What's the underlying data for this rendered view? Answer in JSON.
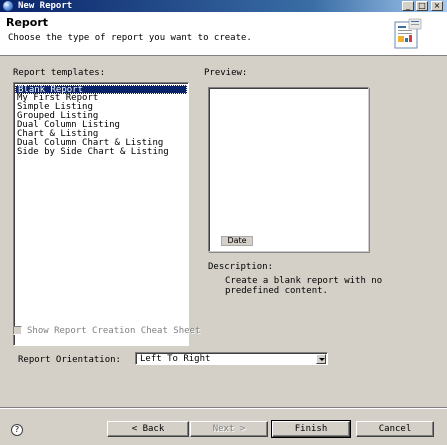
{
  "window": {
    "title": "New Report",
    "controls": [
      "minimize",
      "maximize",
      "close"
    ]
  },
  "header": {
    "title": "Report",
    "description": "Choose the type of report you want to create.",
    "icon": "report-wizard-icon"
  },
  "templates": {
    "label": "Report templates:",
    "selected": "Blank Report",
    "items": [
      "Blank Report",
      "My First Report",
      "Simple Listing",
      "Grouped Listing",
      "Dual Column Listing",
      "Chart & Listing",
      "Dual Column Chart & Listing",
      "Side by Side Chart & Listing"
    ]
  },
  "preview": {
    "label": "Preview:",
    "date_label": "Date"
  },
  "description": {
    "label": "Description:",
    "text": "Create a blank report with no\npredefined content."
  },
  "cheat_sheet": {
    "label": "Show Report Creation Cheat Sheet",
    "checked": false,
    "enabled": false
  },
  "orientation": {
    "label": "Report Orientation:",
    "value": "Left To Right"
  },
  "buttons": {
    "back": "< Back",
    "next": "Next >",
    "finish": "Finish",
    "cancel": "Cancel"
  },
  "help": {
    "symbol": "?"
  },
  "colors": {
    "title_bar": "#0a246a",
    "selection": "#0a246a",
    "dialog_bg": "#d4d0c8"
  }
}
